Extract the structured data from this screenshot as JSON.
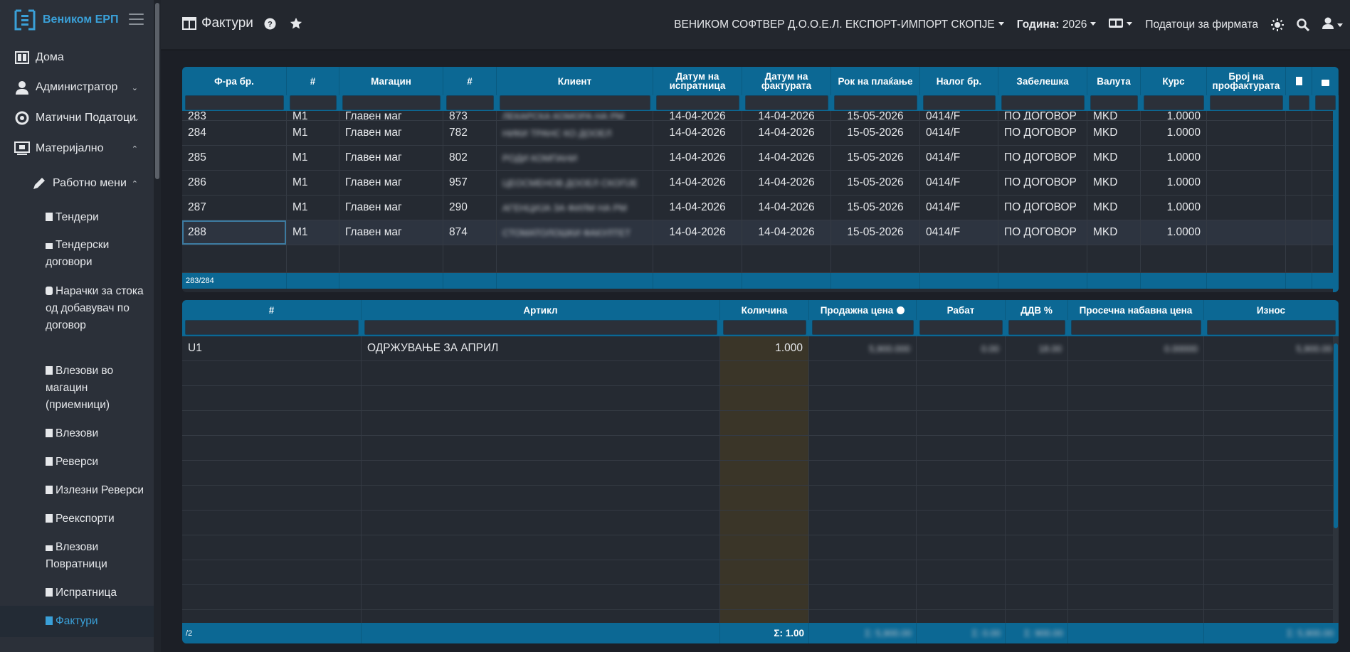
{
  "sidebar": {
    "brand": "Веником ЕРП",
    "items": [
      {
        "label": "Дома"
      },
      {
        "label": "Администратор"
      },
      {
        "label": "Матични Податоци"
      },
      {
        "label": "Материјално"
      },
      {
        "label": "Работно мени"
      }
    ],
    "sub_items": [
      {
        "label": "Тендери"
      },
      {
        "label": "Тендерски договори"
      },
      {
        "label": "Нарачки за стока од добавувач по договор"
      },
      {
        "label": "Влезови во магацин (приемници)"
      },
      {
        "label": "Влезови"
      },
      {
        "label": "Реверси"
      },
      {
        "label": "Излезни Реверси"
      },
      {
        "label": "Реекспорти"
      },
      {
        "label": "Влезови Повратници"
      },
      {
        "label": "Испратница"
      },
      {
        "label": "Фактури"
      }
    ]
  },
  "topbar": {
    "title": "Фактури",
    "company": "ВЕНИКОМ СОФТВЕР Д.О.О.Е.Л. ЕКСПОРТ-ИМПОРТ СКОПЈЕ",
    "year_label": "Година:",
    "year_value": "2026",
    "company_data": "Податоци за фирмата"
  },
  "invoices": {
    "columns": [
      "Ф-ра бр.",
      "#",
      "Магацин",
      "#",
      "Клиент",
      "Датум на испратница",
      "Датум на фактурата",
      "Рок на плаќање",
      "Налог бр.",
      "Забелешка",
      "Валута",
      "Курс",
      "Број на профактурата",
      "",
      ""
    ],
    "partial_row": {
      "num": "283",
      "mag_code": "М1",
      "mag": "Главен маг",
      "id": "873",
      "client": "ЛЕКАРСКА КОМОРА НА РМ",
      "d1": "14-04-2026",
      "d2": "14-04-2026",
      "due": "15-05-2026",
      "order": "0414/F",
      "note": "ПО ДОГОВОР",
      "cur": "MKD",
      "rate": "1.0000"
    },
    "rows": [
      {
        "num": "284",
        "mag_code": "М1",
        "mag": "Главен маг",
        "id": "782",
        "client": "НИКИ ТРАНС КО ДООЕЛ",
        "d1": "14-04-2026",
        "d2": "14-04-2026",
        "due": "15-05-2026",
        "order": "0414/F",
        "note": "ПО ДОГОВОР",
        "cur": "MKD",
        "rate": "1.0000"
      },
      {
        "num": "285",
        "mag_code": "М1",
        "mag": "Главен маг",
        "id": "802",
        "client": "РОДИ КОМПАНИ",
        "d1": "14-04-2026",
        "d2": "14-04-2026",
        "due": "15-05-2026",
        "order": "0414/F",
        "note": "ПО ДОГОВОР",
        "cur": "MKD",
        "rate": "1.0000"
      },
      {
        "num": "286",
        "mag_code": "М1",
        "mag": "Главен маг",
        "id": "957",
        "client": "ЦЕОСМЕНОВ ДООЕЛ СКОПЈЕ",
        "d1": "14-04-2026",
        "d2": "14-04-2026",
        "due": "15-05-2026",
        "order": "0414/F",
        "note": "ПО ДОГОВОР",
        "cur": "MKD",
        "rate": "1.0000"
      },
      {
        "num": "287",
        "mag_code": "М1",
        "mag": "Главен маг",
        "id": "290",
        "client": "АГЕНЦИЈА ЗА ФИЛМ НА РМ",
        "d1": "14-04-2026",
        "d2": "14-04-2026",
        "due": "15-05-2026",
        "order": "0414/F",
        "note": "ПО ДОГОВОР",
        "cur": "MKD",
        "rate": "1.0000"
      },
      {
        "num": "288",
        "mag_code": "М1",
        "mag": "Главен маг",
        "id": "874",
        "client": "СТОМАТОЛОШКИ ФАКУЛТЕТ",
        "d1": "14-04-2026",
        "d2": "14-04-2026",
        "due": "15-05-2026",
        "order": "0414/F",
        "note": "ПО ДОГОВОР",
        "cur": "MKD",
        "rate": "1.0000"
      }
    ],
    "footer_count": "283/284"
  },
  "items": {
    "columns": [
      "#",
      "Артикл",
      "Количина",
      "Продажна цена",
      "Рабат",
      "ДДВ %",
      "Просечна набавна цена",
      "Износ"
    ],
    "rows": [
      {
        "code": "U1",
        "article": "ОДРЖУВАЊЕ ЗА АПРИЛ",
        "qty": "1.000",
        "price": "5,900.000",
        "discount": "0.00",
        "vat": "18.00",
        "avg_cost": "0.00000",
        "amount": "5,900.00"
      }
    ],
    "footer": {
      "count": "/2",
      "qty_sum": "Σ: 1.00",
      "price_sum": "Σ: 5,900.00",
      "discount_sum": "Σ: 0.00",
      "vat_sum": "Σ: 900.00",
      "amount_sum": "Σ: 5,900.00"
    }
  }
}
